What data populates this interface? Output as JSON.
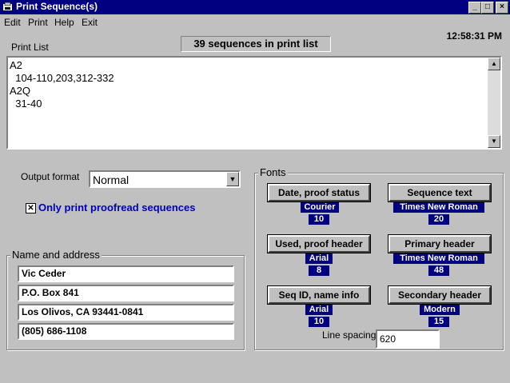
{
  "window": {
    "title": "Print Sequence(s)"
  },
  "menu": [
    "Edit",
    "Print",
    "Help",
    "Exit"
  ],
  "clock": "12:58:31 PM",
  "status_count": "39 sequences in print list",
  "print_list": {
    "label": "Print List",
    "lines": [
      "A2",
      "  104-110,203,312-332",
      "A2Q",
      "  31-40"
    ]
  },
  "output_format": {
    "label": "Output format",
    "value": "Normal"
  },
  "proofread_only": {
    "label": "Only print proofread sequences",
    "checked": true
  },
  "name_address": {
    "label": "Name and address",
    "lines": [
      "Vic Ceder",
      "P.O. Box 841",
      "Los Olivos, CA  93441-0841",
      "(805) 686-1108"
    ]
  },
  "fonts": {
    "label": "Fonts",
    "items": [
      {
        "button": "Date, proof status",
        "font": "Courier",
        "size": "10"
      },
      {
        "button": "Sequence text",
        "font": "Times New Roman",
        "size": "20"
      },
      {
        "button": "Used, proof header",
        "font": "Arial",
        "size": "8"
      },
      {
        "button": "Primary header",
        "font": "Times New Roman",
        "size": "48"
      },
      {
        "button": "Seq ID, name info",
        "font": "Arial",
        "size": "10"
      },
      {
        "button": "Secondary header",
        "font": "Modern",
        "size": "15"
      }
    ],
    "line_spacing": {
      "label": "Line spacing",
      "value": "620"
    }
  }
}
